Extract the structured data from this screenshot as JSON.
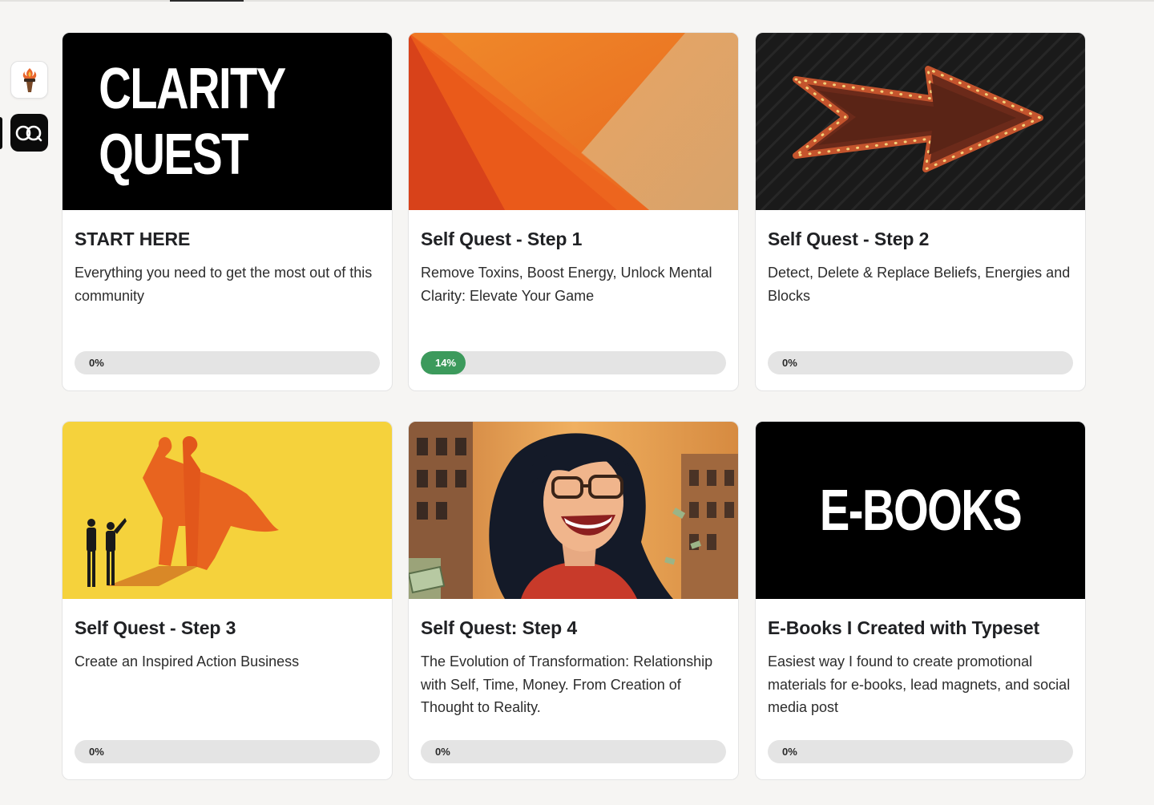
{
  "sidebar": {
    "communities": [
      {
        "name": "torch-community",
        "icon": "torch-icon",
        "active": false
      },
      {
        "name": "oq-community",
        "icon": "oq-logo-icon",
        "active": true
      }
    ]
  },
  "courses": [
    {
      "cover_text": "CLARITY QUEST",
      "title": "START HERE",
      "description": "Everything you need to get the most out of this community",
      "progress_label": "0%",
      "progress": 0
    },
    {
      "cover_text": "",
      "title": "Self Quest - Step 1",
      "description": "Remove Toxins, Boost Energy, Unlock Mental Clarity: Elevate Your Game",
      "progress_label": "14%",
      "progress": 14
    },
    {
      "cover_text": "",
      "title": "Self Quest - Step 2",
      "description": "Detect, Delete & Replace Beliefs, Energies and Blocks",
      "progress_label": "0%",
      "progress": 0
    },
    {
      "cover_text": "",
      "title": "Self Quest - Step 3",
      "description": "Create an Inspired Action Business",
      "progress_label": "0%",
      "progress": 0
    },
    {
      "cover_text": "",
      "title": "Self Quest: Step 4",
      "description": "The Evolution of Transformation: Relationship with Self, Time, Money. From Creation of Thought to Reality.",
      "progress_label": "0%",
      "progress": 0
    },
    {
      "cover_text": "E-BOOKS",
      "title": "E-Books I Created with Typeset",
      "description": "Easiest way I found to create promotional materials for e-books, lead magnets, and social media post",
      "progress_label": "0%",
      "progress": 0
    }
  ],
  "colors": {
    "progress_fill": "#3c9a5c",
    "progress_track": "#e4e4e4",
    "background": "#f6f5f3"
  }
}
